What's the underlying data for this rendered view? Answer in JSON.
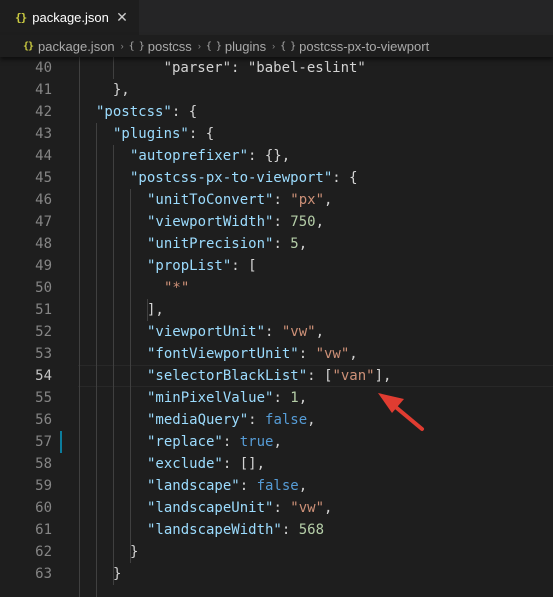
{
  "tab": {
    "icon": "{}",
    "label": "package.json",
    "close_glyph": "✕"
  },
  "breadcrumb": [
    {
      "icon": "{}",
      "label": "package.json"
    },
    {
      "icon": "{ }",
      "label": "postcss"
    },
    {
      "icon": "{ }",
      "label": "plugins"
    },
    {
      "icon": "{ }",
      "label": "postcss-px-to-viewport"
    }
  ],
  "breadcrumb_separator": "›",
  "colors": {
    "background": "#1e1e1e",
    "key": "#9cdcfe",
    "string": "#ce9178",
    "number": "#b5cea8",
    "boolean": "#569cd6",
    "punctuation": "#d4d4d4",
    "line_number": "#858585",
    "arrow": "#e03c31",
    "modified_marker": "#0c7d9d"
  },
  "editor": {
    "current_line": "54",
    "lines": [
      {
        "n": "40",
        "tokens": [
          {
            "t": "p",
            "v": "      \"parser\": \"babel-eslint\""
          }
        ]
      },
      {
        "n": "41",
        "tokens": [
          {
            "t": "p",
            "v": "  },"
          }
        ]
      },
      {
        "n": "42",
        "tokens": [
          {
            "t": "k",
            "v": "\"postcss\""
          },
          {
            "t": "p",
            "v": ": {"
          }
        ]
      },
      {
        "n": "43",
        "tokens": [
          {
            "t": "k",
            "v": "\"plugins\""
          },
          {
            "t": "p",
            "v": ": {"
          }
        ]
      },
      {
        "n": "44",
        "tokens": [
          {
            "t": "k",
            "v": "\"autoprefixer\""
          },
          {
            "t": "p",
            "v": ": {},"
          }
        ]
      },
      {
        "n": "45",
        "tokens": [
          {
            "t": "k",
            "v": "\"postcss-px-to-viewport\""
          },
          {
            "t": "p",
            "v": ": {"
          }
        ]
      },
      {
        "n": "46",
        "tokens": [
          {
            "t": "k",
            "v": "\"unitToConvert\""
          },
          {
            "t": "p",
            "v": ": "
          },
          {
            "t": "s",
            "v": "\"px\""
          },
          {
            "t": "p",
            "v": ","
          }
        ]
      },
      {
        "n": "47",
        "tokens": [
          {
            "t": "k",
            "v": "\"viewportWidth\""
          },
          {
            "t": "p",
            "v": ": "
          },
          {
            "t": "n",
            "v": "750"
          },
          {
            "t": "p",
            "v": ","
          }
        ]
      },
      {
        "n": "48",
        "tokens": [
          {
            "t": "k",
            "v": "\"unitPrecision\""
          },
          {
            "t": "p",
            "v": ": "
          },
          {
            "t": "n",
            "v": "5"
          },
          {
            "t": "p",
            "v": ","
          }
        ]
      },
      {
        "n": "49",
        "tokens": [
          {
            "t": "k",
            "v": "\"propList\""
          },
          {
            "t": "p",
            "v": ": ["
          }
        ]
      },
      {
        "n": "50",
        "tokens": [
          {
            "t": "s",
            "v": "\"*\""
          }
        ]
      },
      {
        "n": "51",
        "tokens": [
          {
            "t": "p",
            "v": "],"
          }
        ]
      },
      {
        "n": "52",
        "tokens": [
          {
            "t": "k",
            "v": "\"viewportUnit\""
          },
          {
            "t": "p",
            "v": ": "
          },
          {
            "t": "s",
            "v": "\"vw\""
          },
          {
            "t": "p",
            "v": ","
          }
        ]
      },
      {
        "n": "53",
        "tokens": [
          {
            "t": "k",
            "v": "\"fontViewportUnit\""
          },
          {
            "t": "p",
            "v": ": "
          },
          {
            "t": "s",
            "v": "\"vw\""
          },
          {
            "t": "p",
            "v": ","
          }
        ]
      },
      {
        "n": "54",
        "tokens": [
          {
            "t": "k",
            "v": "\"selectorBlackList\""
          },
          {
            "t": "p",
            "v": ": ["
          },
          {
            "t": "s",
            "v": "\"van\""
          },
          {
            "t": "p",
            "v": "],"
          }
        ]
      },
      {
        "n": "55",
        "tokens": [
          {
            "t": "k",
            "v": "\"minPixelValue\""
          },
          {
            "t": "p",
            "v": ": "
          },
          {
            "t": "n",
            "v": "1"
          },
          {
            "t": "p",
            "v": ","
          }
        ]
      },
      {
        "n": "56",
        "tokens": [
          {
            "t": "k",
            "v": "\"mediaQuery\""
          },
          {
            "t": "p",
            "v": ": "
          },
          {
            "t": "b",
            "v": "false"
          },
          {
            "t": "p",
            "v": ","
          }
        ]
      },
      {
        "n": "57",
        "tokens": [
          {
            "t": "k",
            "v": "\"replace\""
          },
          {
            "t": "p",
            "v": ": "
          },
          {
            "t": "b",
            "v": "true"
          },
          {
            "t": "p",
            "v": ","
          }
        ]
      },
      {
        "n": "58",
        "tokens": [
          {
            "t": "k",
            "v": "\"exclude\""
          },
          {
            "t": "p",
            "v": ": [],"
          }
        ]
      },
      {
        "n": "59",
        "tokens": [
          {
            "t": "k",
            "v": "\"landscape\""
          },
          {
            "t": "p",
            "v": ": "
          },
          {
            "t": "b",
            "v": "false"
          },
          {
            "t": "p",
            "v": ","
          }
        ]
      },
      {
        "n": "60",
        "tokens": [
          {
            "t": "k",
            "v": "\"landscapeUnit\""
          },
          {
            "t": "p",
            "v": ": "
          },
          {
            "t": "s",
            "v": "\"vw\""
          },
          {
            "t": "p",
            "v": ","
          }
        ]
      },
      {
        "n": "61",
        "tokens": [
          {
            "t": "k",
            "v": "\"landscapeWidth\""
          },
          {
            "t": "p",
            "v": ": "
          },
          {
            "t": "n",
            "v": "568"
          }
        ]
      },
      {
        "n": "62",
        "tokens": [
          {
            "t": "p",
            "v": "}"
          }
        ]
      },
      {
        "n": "63",
        "tokens": [
          {
            "t": "p",
            "v": "}"
          }
        ]
      }
    ]
  }
}
